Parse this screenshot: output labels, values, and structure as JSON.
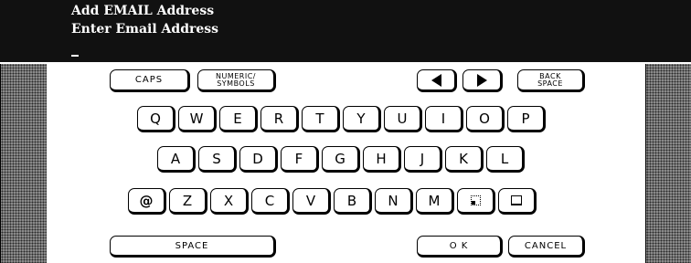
{
  "header": {
    "title": "Add EMAIL Address",
    "prompt": "Enter Email Address",
    "input_value": ""
  },
  "controls": {
    "caps": "CAPS",
    "numeric_line1": "NUMERIC/",
    "numeric_line2": "SYMBOLS",
    "back_line1": "BACK",
    "back_line2": "SPACE",
    "left_arrow_icon": "arrow-left-icon",
    "right_arrow_icon": "arrow-right-icon"
  },
  "keys": {
    "row1": [
      "Q",
      "W",
      "E",
      "R",
      "T",
      "Y",
      "U",
      "I",
      "O",
      "P"
    ],
    "row2": [
      "A",
      "S",
      "D",
      "F",
      "G",
      "H",
      "J",
      "K",
      "L"
    ],
    "row3": [
      "@",
      "Z",
      "X",
      "C",
      "V",
      "B",
      "N",
      "M"
    ],
    "row3_icons": [
      "dot-square-icon",
      "underscore-square-icon"
    ]
  },
  "bottom": {
    "space": "SPACE",
    "ok": "O K",
    "cancel": "CANCEL"
  }
}
